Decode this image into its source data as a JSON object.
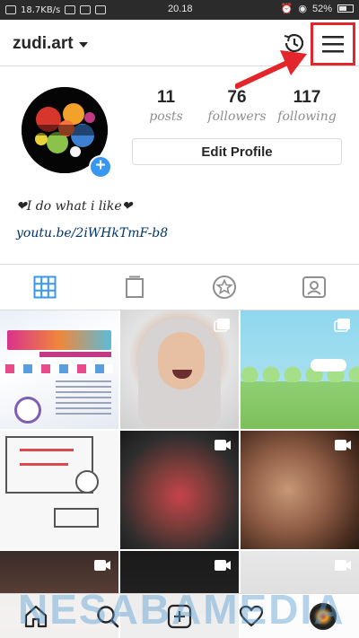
{
  "status_bar": {
    "speed": "18.7KB/s",
    "time": "20.18",
    "battery": "52%"
  },
  "header": {
    "username": "zudi.art",
    "history_icon": "history-icon",
    "menu_icon": "hamburger-menu-icon"
  },
  "profile": {
    "stats": [
      {
        "value": "11",
        "label": "posts"
      },
      {
        "value": "76",
        "label": "followers"
      },
      {
        "value": "117",
        "label": "following"
      }
    ],
    "edit_button": "Edit Profile",
    "bio": "❤I do what i like❤",
    "link": "youtu.be/2iWHkTmF-b8"
  },
  "tabs": [
    "grid-icon",
    "igtv-icon",
    "saved-star-icon",
    "tagged-icon"
  ],
  "bottom_nav": [
    "home-icon",
    "search-icon",
    "add-post-icon",
    "activity-heart-icon",
    "profile-avatar"
  ],
  "watermark": "NESABAMEDIA",
  "colors": {
    "accent_blue": "#3897f0",
    "annotation_red": "#e3262b",
    "text": "#262626",
    "muted": "#8e8e8e"
  }
}
